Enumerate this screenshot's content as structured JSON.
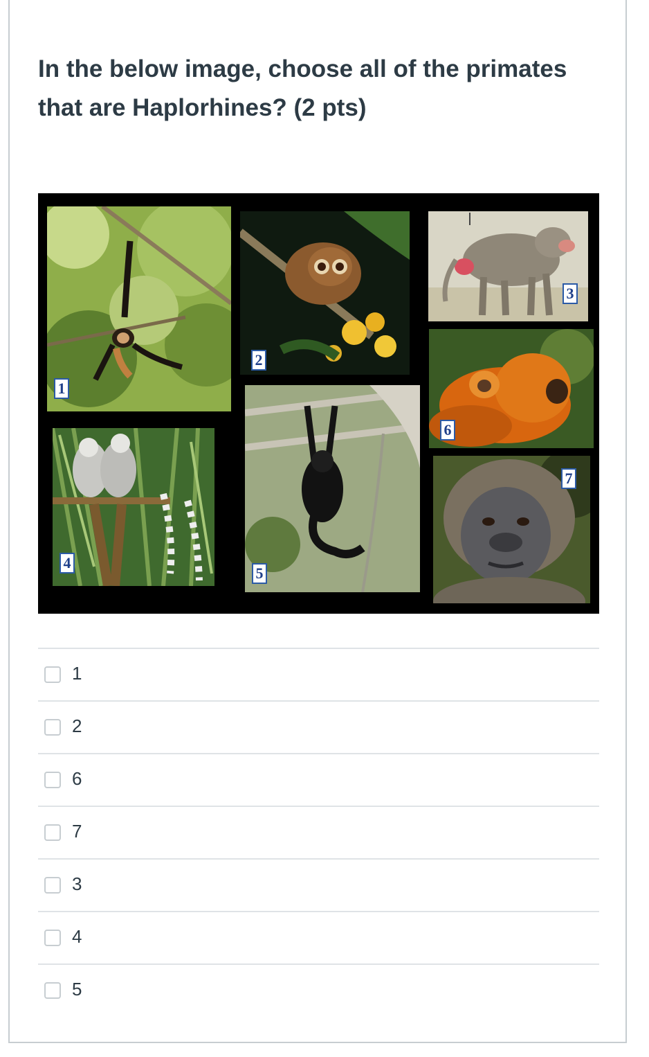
{
  "question": {
    "text": "In the below image, choose all of the primates that are Haplorhines? (2 pts)"
  },
  "figure": {
    "photos": [
      {
        "tag": "1",
        "subject": "spider monkey hanging by tail"
      },
      {
        "tag": "2",
        "subject": "slow loris on branch with yellow flowers"
      },
      {
        "tag": "3",
        "subject": "hamadryas baboon"
      },
      {
        "tag": "4",
        "subject": "ring-tailed lemurs on platform"
      },
      {
        "tag": "5",
        "subject": "gibbon hanging from bars"
      },
      {
        "tag": "6",
        "subject": "golden lion tamarin with infant"
      },
      {
        "tag": "7",
        "subject": "gorilla face"
      }
    ]
  },
  "answers": [
    {
      "label": "1",
      "checked": false
    },
    {
      "label": "2",
      "checked": false
    },
    {
      "label": "6",
      "checked": false
    },
    {
      "label": "7",
      "checked": false
    },
    {
      "label": "3",
      "checked": false
    },
    {
      "label": "4",
      "checked": false
    },
    {
      "label": "5",
      "checked": false
    }
  ]
}
